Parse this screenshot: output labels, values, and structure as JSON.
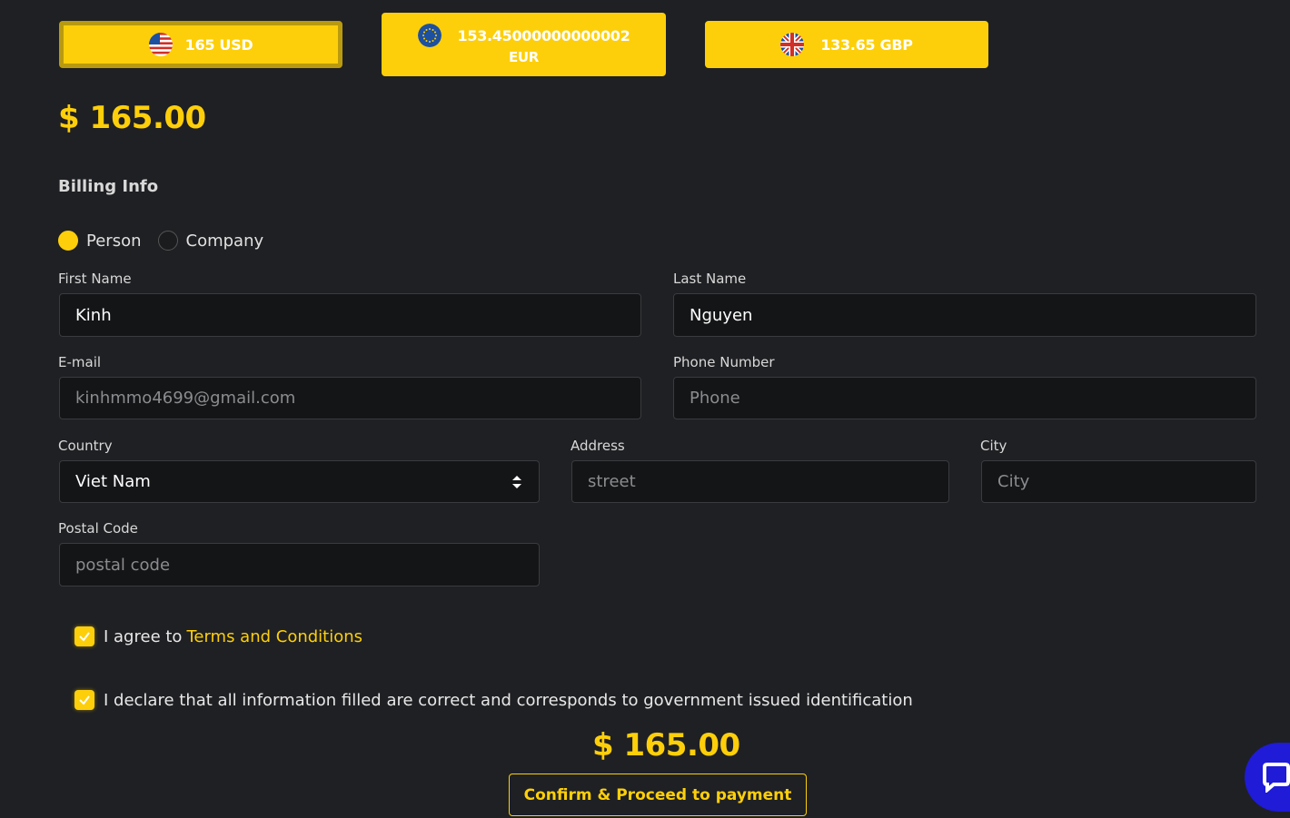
{
  "currencies": [
    {
      "label": "165 USD",
      "code": "USD",
      "active": true,
      "flag": "us-flag-icon"
    },
    {
      "label": "153.45000000000002",
      "sub": "EUR",
      "code": "EUR",
      "active": false,
      "flag": "eu-flag-icon"
    },
    {
      "label": "133.65 GBP",
      "code": "GBP",
      "active": false,
      "flag": "uk-flag-icon"
    }
  ],
  "amount_top": "$ 165.00",
  "billing": {
    "title": "Billing Info",
    "type_options": [
      {
        "label": "Person",
        "selected": true
      },
      {
        "label": "Company",
        "selected": false
      }
    ]
  },
  "form": {
    "first_name": {
      "label": "First Name",
      "value": "Kinh",
      "placeholder": ""
    },
    "last_name": {
      "label": "Last Name",
      "value": "Nguyen",
      "placeholder": ""
    },
    "email": {
      "label": "E-mail",
      "value": "",
      "placeholder": "kinhmmo4699@gmail.com"
    },
    "phone": {
      "label": "Phone Number",
      "value": "",
      "placeholder": "Phone"
    },
    "country": {
      "label": "Country",
      "value": "Viet Nam"
    },
    "address": {
      "label": "Address",
      "value": "",
      "placeholder": "street"
    },
    "city": {
      "label": "City",
      "value": "",
      "placeholder": "City"
    },
    "postal": {
      "label": "Postal Code",
      "value": "",
      "placeholder": "postal code"
    }
  },
  "agreements": {
    "terms_prefix": "I agree to",
    "terms_link": "Terms and Conditions",
    "terms_checked": true,
    "declare_text": "I declare that all information filled are correct and corresponds to government issued identification",
    "declare_checked": true
  },
  "amount_bottom": "$ 165.00",
  "confirm_label": "Confirm & Proceed to payment",
  "colors": {
    "accent": "#fdcf0a",
    "background": "#1f2023",
    "input_bg": "#141517",
    "chat": "#1f1bd6"
  },
  "chat_icon": "chat-icon"
}
